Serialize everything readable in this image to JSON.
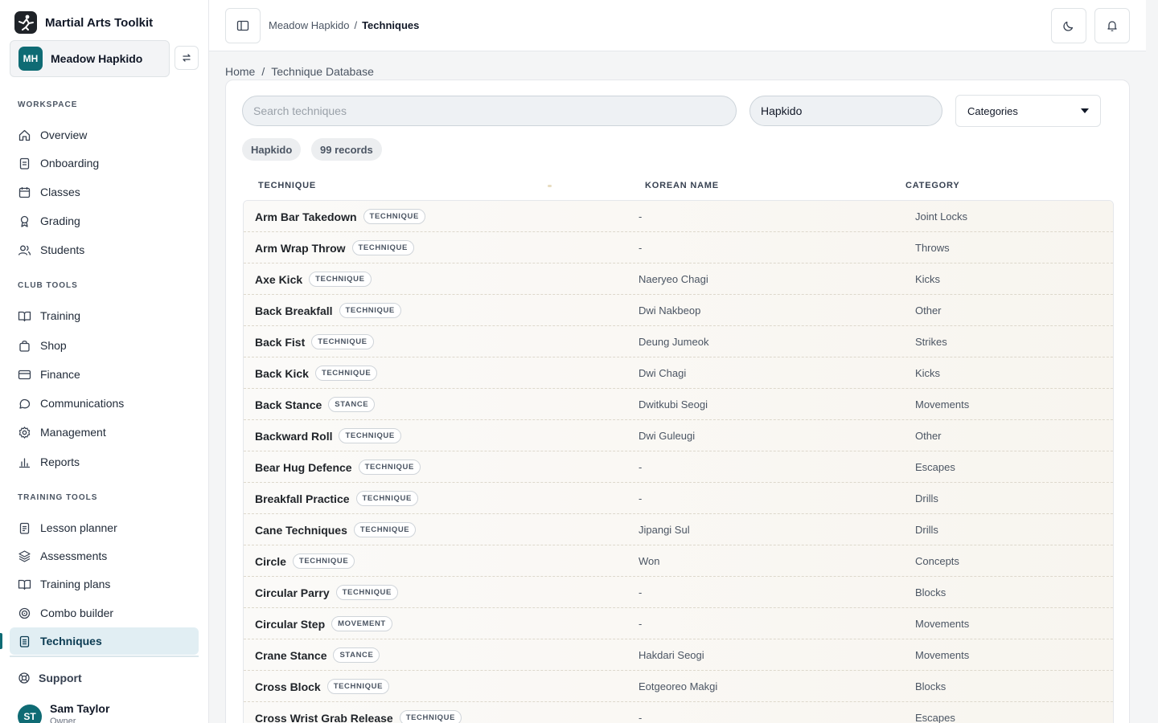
{
  "app": {
    "name": "Martial Arts Toolkit"
  },
  "club": {
    "initials": "MH",
    "name": "Meadow Hapkido"
  },
  "sidebar": {
    "sections": [
      {
        "title": "WORKSPACE",
        "items": [
          "Overview",
          "Onboarding",
          "Classes",
          "Grading",
          "Students"
        ]
      },
      {
        "title": "CLUB TOOLS",
        "items": [
          "Training",
          "Shop",
          "Finance",
          "Communications",
          "Management",
          "Reports"
        ]
      },
      {
        "title": "TRAINING TOOLS",
        "items": [
          "Lesson planner",
          "Assessments",
          "Training plans",
          "Combo builder",
          "Techniques"
        ]
      }
    ],
    "active_item": "Techniques",
    "support": "Support",
    "user": {
      "initials": "ST",
      "name": "Sam Taylor",
      "role": "Owner"
    }
  },
  "header": {
    "breadcrumb": [
      "Meadow Hapkido",
      "Techniques"
    ],
    "separator": "/"
  },
  "page": {
    "breadcrumb": [
      "Home",
      "Technique Database"
    ],
    "separator": "/",
    "search_placeholder": "Search techniques",
    "style_value": "Hapkido",
    "category_select": "Categories",
    "chips": [
      "Hapkido",
      "99 records"
    ]
  },
  "table": {
    "columns": [
      "TECHNIQUE",
      "KOREAN NAME",
      "CATEGORY"
    ],
    "rows": [
      {
        "name": "Arm Bar Takedown",
        "type": "TECHNIQUE",
        "korean": "-",
        "category": "Joint Locks"
      },
      {
        "name": "Arm Wrap Throw",
        "type": "TECHNIQUE",
        "korean": "-",
        "category": "Throws"
      },
      {
        "name": "Axe Kick",
        "type": "TECHNIQUE",
        "korean": "Naeryeo Chagi",
        "category": "Kicks"
      },
      {
        "name": "Back Breakfall",
        "type": "TECHNIQUE",
        "korean": "Dwi Nakbeop",
        "category": "Other"
      },
      {
        "name": "Back Fist",
        "type": "TECHNIQUE",
        "korean": "Deung Jumeok",
        "category": "Strikes"
      },
      {
        "name": "Back Kick",
        "type": "TECHNIQUE",
        "korean": "Dwi Chagi",
        "category": "Kicks"
      },
      {
        "name": "Back Stance",
        "type": "STANCE",
        "korean": "Dwitkubi Seogi",
        "category": "Movements"
      },
      {
        "name": "Backward Roll",
        "type": "TECHNIQUE",
        "korean": "Dwi Guleugi",
        "category": "Other"
      },
      {
        "name": "Bear Hug Defence",
        "type": "TECHNIQUE",
        "korean": "-",
        "category": "Escapes"
      },
      {
        "name": "Breakfall Practice",
        "type": "TECHNIQUE",
        "korean": "-",
        "category": "Drills"
      },
      {
        "name": "Cane Techniques",
        "type": "TECHNIQUE",
        "korean": "Jipangi Sul",
        "category": "Drills"
      },
      {
        "name": "Circle",
        "type": "TECHNIQUE",
        "korean": "Won",
        "category": "Concepts"
      },
      {
        "name": "Circular Parry",
        "type": "TECHNIQUE",
        "korean": "-",
        "category": "Blocks"
      },
      {
        "name": "Circular Step",
        "type": "MOVEMENT",
        "korean": "-",
        "category": "Movements"
      },
      {
        "name": "Crane Stance",
        "type": "STANCE",
        "korean": "Hakdari Seogi",
        "category": "Movements"
      },
      {
        "name": "Cross Block",
        "type": "TECHNIQUE",
        "korean": "Eotgeoreo Makgi",
        "category": "Blocks"
      },
      {
        "name": "Cross Wrist Grab Release",
        "type": "TECHNIQUE",
        "korean": "-",
        "category": "Escapes"
      }
    ]
  }
}
